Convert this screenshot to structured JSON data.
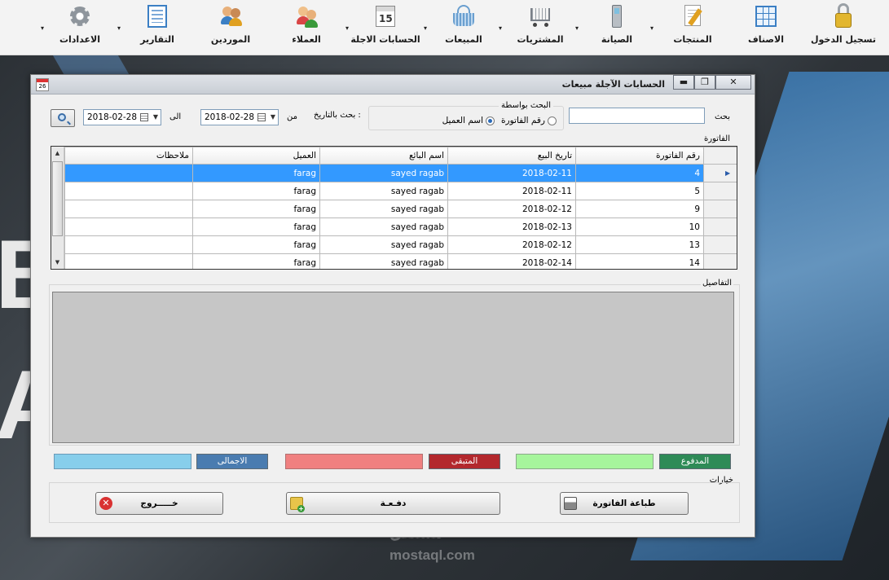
{
  "toolbar": {
    "items": [
      {
        "label": "تسجيل الدخول",
        "icon": "lock-icon"
      },
      {
        "label": "الاصناف",
        "icon": "table-icon"
      },
      {
        "label": "المنتجات",
        "icon": "document-edit-icon"
      },
      {
        "label": "الصيانة",
        "icon": "mobile-phone-icon"
      },
      {
        "label": "المشتريات",
        "icon": "shopping-cart-icon"
      },
      {
        "label": "المبيعات",
        "icon": "basket-icon"
      },
      {
        "label": "الحسابات الاجلة",
        "icon": "calendar-icon",
        "calendar_day": "15"
      },
      {
        "label": "العملاء",
        "icon": "customers-icon"
      },
      {
        "label": "الموردين",
        "icon": "suppliers-icon"
      },
      {
        "label": "التقارير",
        "icon": "report-icon"
      },
      {
        "label": "الاعدادات",
        "icon": "gear-icon"
      }
    ],
    "dropdown_glyph": "▾"
  },
  "window": {
    "title": "الحسابات الآجلة مبيعات",
    "icon_day": "26",
    "buttons": {
      "minimize": "▬",
      "maximize": "❐",
      "close": "✕"
    }
  },
  "search": {
    "label": "بحث",
    "value": "",
    "group_title": "البحث بواسطة",
    "options": [
      {
        "label": "رقم الفاتورة",
        "selected": false
      },
      {
        "label": "اسم العميل",
        "selected": true
      }
    ],
    "date_label": "بحث بالتاريخ :",
    "from_label": "من",
    "to_label": "الى",
    "date_from": "2018-02-28",
    "date_to": "2018-02-28"
  },
  "invoices": {
    "section_label": "الفاتورة",
    "columns": [
      "رقم الفاتورة",
      "تاريخ البيع",
      "اسم البائع",
      "العميل",
      "ملاحظات"
    ],
    "rows": [
      {
        "id": "4",
        "date": "2018-02-11",
        "seller": "sayed ragab",
        "customer": "farag",
        "notes": ""
      },
      {
        "id": "5",
        "date": "2018-02-11",
        "seller": "sayed ragab",
        "customer": "farag",
        "notes": ""
      },
      {
        "id": "9",
        "date": "2018-02-12",
        "seller": "sayed ragab",
        "customer": "farag",
        "notes": ""
      },
      {
        "id": "10",
        "date": "2018-02-13",
        "seller": "sayed ragab",
        "customer": "farag",
        "notes": ""
      },
      {
        "id": "13",
        "date": "2018-02-12",
        "seller": "sayed ragab",
        "customer": "farag",
        "notes": ""
      },
      {
        "id": "14",
        "date": "2018-02-14",
        "seller": "sayed ragab",
        "customer": "farag",
        "notes": ""
      }
    ],
    "selected_row_marker": "▶"
  },
  "details": {
    "section_label": "التفاصيل"
  },
  "totals": {
    "paid_label": "المدفوع",
    "paid_value": "",
    "remaining_label": "المتبقى",
    "remaining_value": "",
    "total_label": "الاجمالى",
    "total_value": "",
    "colors": {
      "paid": "#2e8b57",
      "paid_box": "#a6f59c",
      "remaining": "#b3282d",
      "remaining_box": "#f08080",
      "total": "#4a7cb0",
      "total_box": "#87ceeb"
    }
  },
  "options": {
    "section_label": "خيارات",
    "print_label": "طباعة الفاتورة",
    "pay_label": "دفـعـة",
    "exit_label": "خـــــروج"
  },
  "watermark": {
    "arabic": "مستقل",
    "latin": "mostaql.com"
  }
}
